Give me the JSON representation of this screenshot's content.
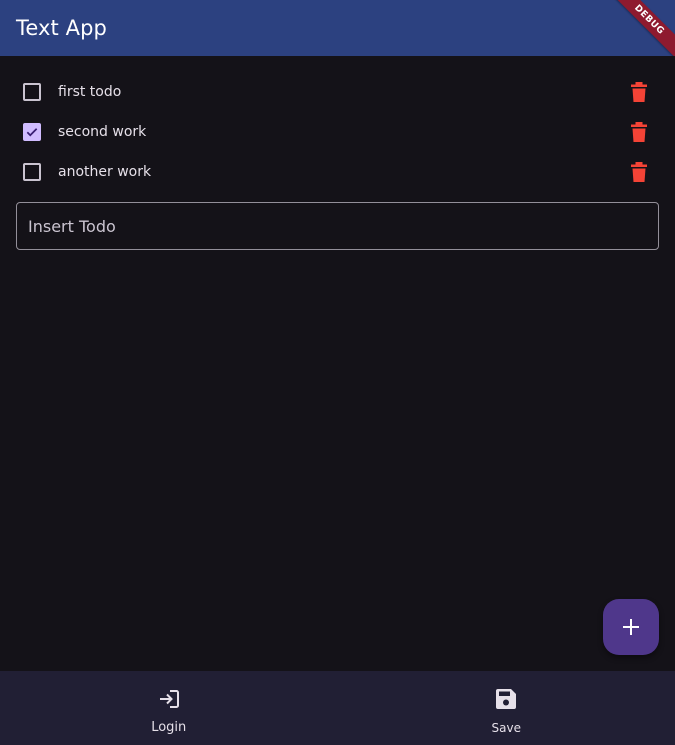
{
  "app_bar": {
    "title": "Text App",
    "debug_banner": "DEBUG"
  },
  "todos": [
    {
      "label": "first todo",
      "checked": false
    },
    {
      "label": "second work",
      "checked": true
    },
    {
      "label": "another work",
      "checked": false
    }
  ],
  "input": {
    "placeholder": "Insert Todo",
    "value": ""
  },
  "fab": {
    "icon": "plus-icon"
  },
  "bottom_nav": {
    "items": [
      {
        "label": "Login",
        "icon": "login-icon"
      },
      {
        "label": "Save",
        "icon": "save-icon"
      }
    ]
  },
  "colors": {
    "app_bar": "#2c4180",
    "background": "#141218",
    "checkbox_checked": "#d0bcff",
    "delete_icon": "#f44336",
    "fab": "#4f378b",
    "bottom_nav": "#211f34"
  }
}
